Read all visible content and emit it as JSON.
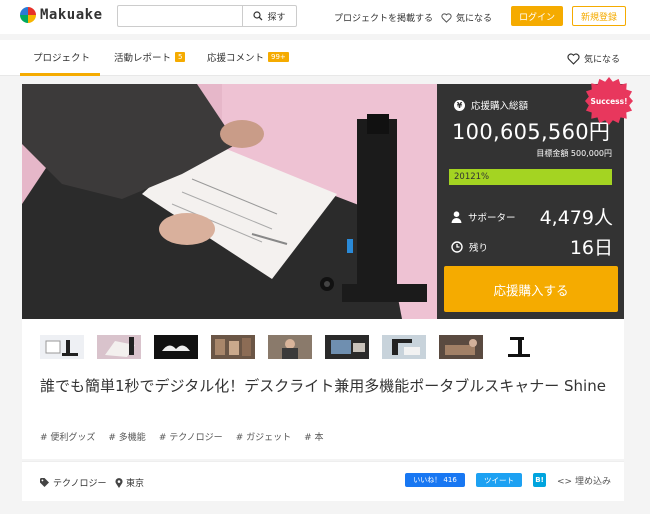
{
  "header": {
    "logo_text": "Makuake",
    "search": {
      "placeholder": "",
      "button_label": "探す"
    },
    "post_project": "プロジェクトを掲載する",
    "favorites": "気になる",
    "login": "ログイン",
    "register": "新規登録"
  },
  "tabs": {
    "project": "プロジェクト",
    "report": "活動レポート",
    "report_count": "5",
    "comments": "応援コメント",
    "comments_count": "99+",
    "favorite": "気になる"
  },
  "funding": {
    "label": "応援購入総額",
    "amount": "100,605,560円",
    "target": "目標金額 500,000円",
    "percent_text": "20121%",
    "badge": "Success!",
    "supporters_label": "サポーター",
    "supporters_value": "4,479人",
    "days_label": "残り",
    "days_value": "16日",
    "buy_button": "応援購入する"
  },
  "project": {
    "title": "誰でも簡単1秒でデジタル化！デスクライト兼用多機能ポータブルスキャナー Shine",
    "tags": [
      "# 便利グッズ",
      "# 多機能",
      "# テクノロジー",
      "# ガジェット",
      "# 本"
    ],
    "category": "テクノロジー",
    "location": "東京"
  },
  "share": {
    "facebook": "いいね！ 416",
    "twitter": "ツイート",
    "hatena": "B!",
    "embed": "<> 埋め込み"
  },
  "colors": {
    "accent": "#f5ab00",
    "sidebar_bg": "#333333",
    "progress": "#a4d422",
    "success_badge": "#e8375d"
  }
}
